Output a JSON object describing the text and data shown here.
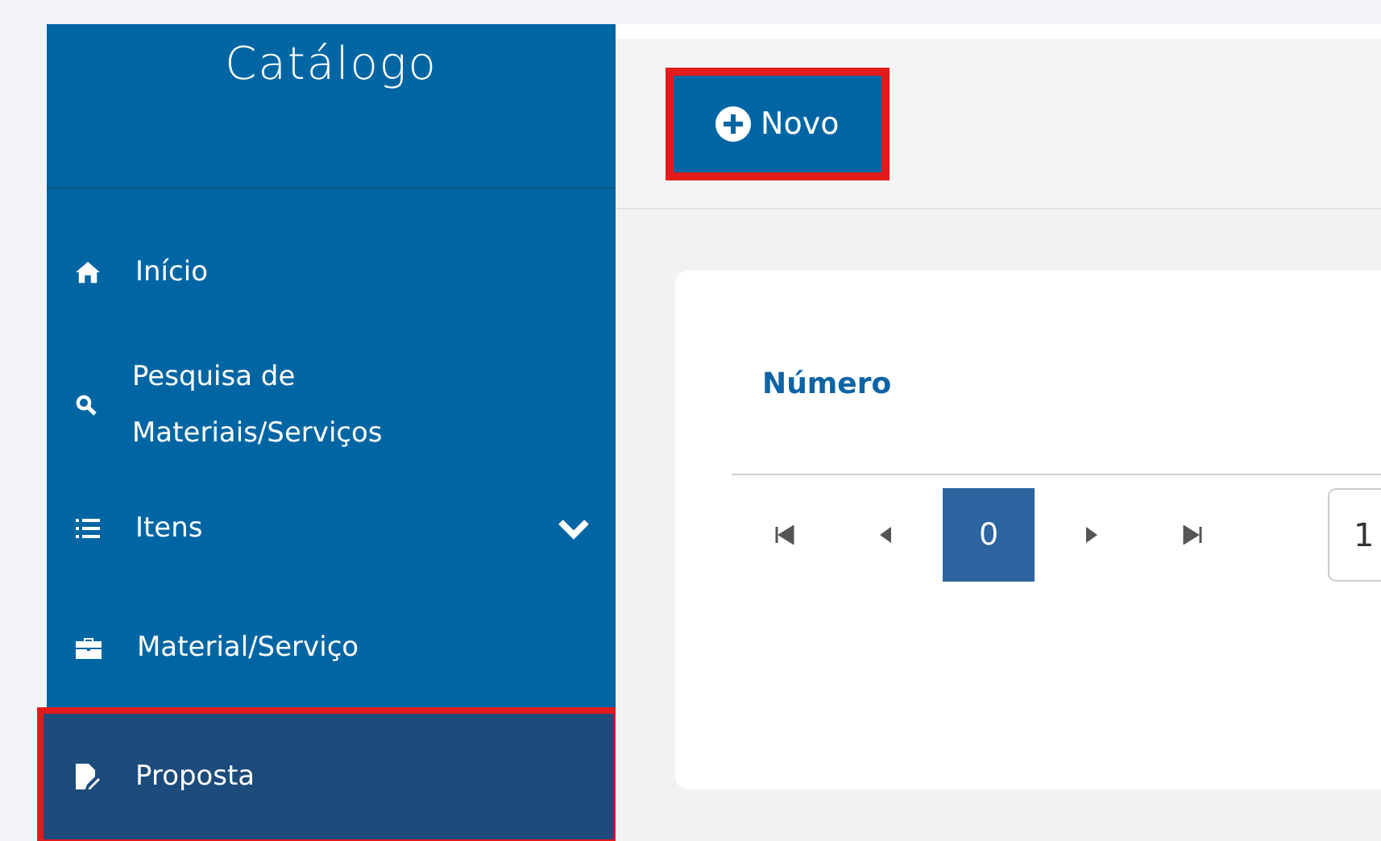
{
  "sidebar": {
    "title": "Catálogo",
    "items": [
      {
        "kind": "home",
        "label": "Início",
        "selected": false,
        "highlighted": false
      },
      {
        "kind": "search",
        "label": "Pesquisa de Materiais/Serviços",
        "selected": false,
        "highlighted": false
      },
      {
        "kind": "list",
        "label": "Itens",
        "selected": false,
        "highlighted": false,
        "expanded": false
      },
      {
        "kind": "briefcase",
        "label": "Material/Serviço",
        "selected": false,
        "highlighted": false
      },
      {
        "kind": "edit",
        "label": "Proposta",
        "selected": true,
        "highlighted": true
      }
    ]
  },
  "toolbar": {
    "new_button": {
      "label": "Novo",
      "highlighted": true
    }
  },
  "table": {
    "columns": [
      "Número"
    ]
  },
  "pager": {
    "pages": [
      {
        "label": "0",
        "selected": true
      }
    ],
    "page_size": "1"
  }
}
